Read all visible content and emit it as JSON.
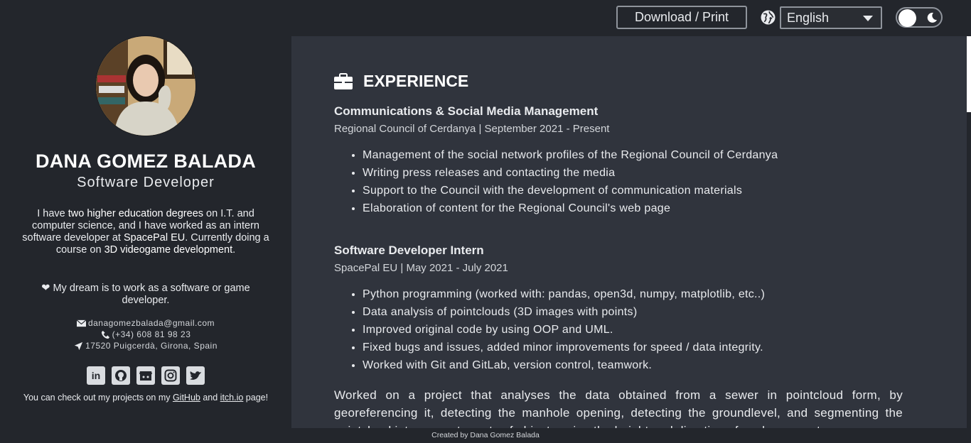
{
  "topbar": {
    "download_label": "Download / Print",
    "globe_icon": "globe-icon",
    "language_selected": "English",
    "theme_toggle_icon": "moon-icon"
  },
  "profile": {
    "name": "DANA GOMEZ BALADA",
    "role": "Software Developer",
    "bio": {
      "p1": "I have ",
      "p1_bold": "two higher education degrees",
      "p2": " on I.T. and computer science, and I have worked as an intern software developer at ",
      "p2_bold": "SpacePal EU",
      "p3": ". Currently doing a course on ",
      "p3_bold": "3D videogame development",
      "p4": "."
    },
    "dream": "❤ My dream is to work as a software or game developer.",
    "email": "danagomezbalada@gmail.com",
    "phone": "(+34) 608 81 98 23",
    "location": "17520 Puigcerdà, Girona, Spain",
    "socials": [
      "linkedin-icon",
      "github-icon",
      "itchio-icon",
      "instagram-icon",
      "twitter-icon"
    ],
    "projects_note": {
      "before": "You can check out my projects on my ",
      "github": "GitHub",
      "middle": " and ",
      "itch": "itch.io",
      "after": " page!"
    }
  },
  "experience": {
    "title": "EXPERIENCE",
    "jobs": [
      {
        "title": "Communications & Social Media Management",
        "meta": "Regional Council of Cerdanya | September 2021 - Present",
        "items": [
          "Management of the social network profiles of the Regional Council of Cerdanya",
          "Writing press releases and contacting the media",
          "Support to the Council with the development of communication materials",
          "Elaboration of content for the Regional Council's web page"
        ]
      },
      {
        "title": "Software Developer Intern",
        "meta": "SpacePal EU | May 2021 - July 2021",
        "items": [
          "Python programming (worked with: pandas, open3d, numpy, matplotlib, etc..)",
          "Data analysis of pointclouds (3D images with points)",
          "Improved original code by using OOP and UML.",
          "Fixed bugs and issues, added minor improvements for speed / data integrity.",
          "Worked with Git and GitLab, version control, teamwork."
        ]
      }
    ],
    "description": "Worked on a project that analyses the data obtained from a sewer in pointcloud form, by georeferencing it, detecting the manhole opening, detecting the groundlevel, and segmenting the pointcloud into separate parts of objects using the height and direction of each segment"
  },
  "footer": {
    "text": "Created by Dana Gomez Balada"
  }
}
